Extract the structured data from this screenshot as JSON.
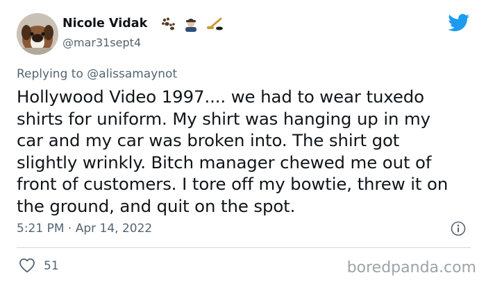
{
  "author": {
    "name": "Nicole Vidak",
    "handle": "@mar31sept4",
    "emoji_icons": [
      "paw-prints-icon",
      "woman-with-hat-icon",
      "hockey-stick-puck-icon"
    ]
  },
  "reply": {
    "prefix": "Replying to",
    "mention": "@alissamaynot"
  },
  "tweet": {
    "lines": [
      "Hollywood Video 1997.... we had to wear tuxedo",
      "shirts for uniform. My shirt was hanging up in my",
      "car and my car was broken into. The shirt got",
      "slightly wrinkly. Bitch manager chewed me out of",
      "front of customers. I tore off my bowtie, threw it on",
      "the ground, and quit on the spot."
    ],
    "timestamp": "5:21 PM · Apr 14, 2022"
  },
  "engagement": {
    "likes": "51"
  },
  "watermark": "boredpanda.com",
  "colors": {
    "twitter_blue": "#1d9bf0",
    "text_primary": "#0f1419",
    "text_secondary": "#536471",
    "divider": "#cfd9de"
  }
}
